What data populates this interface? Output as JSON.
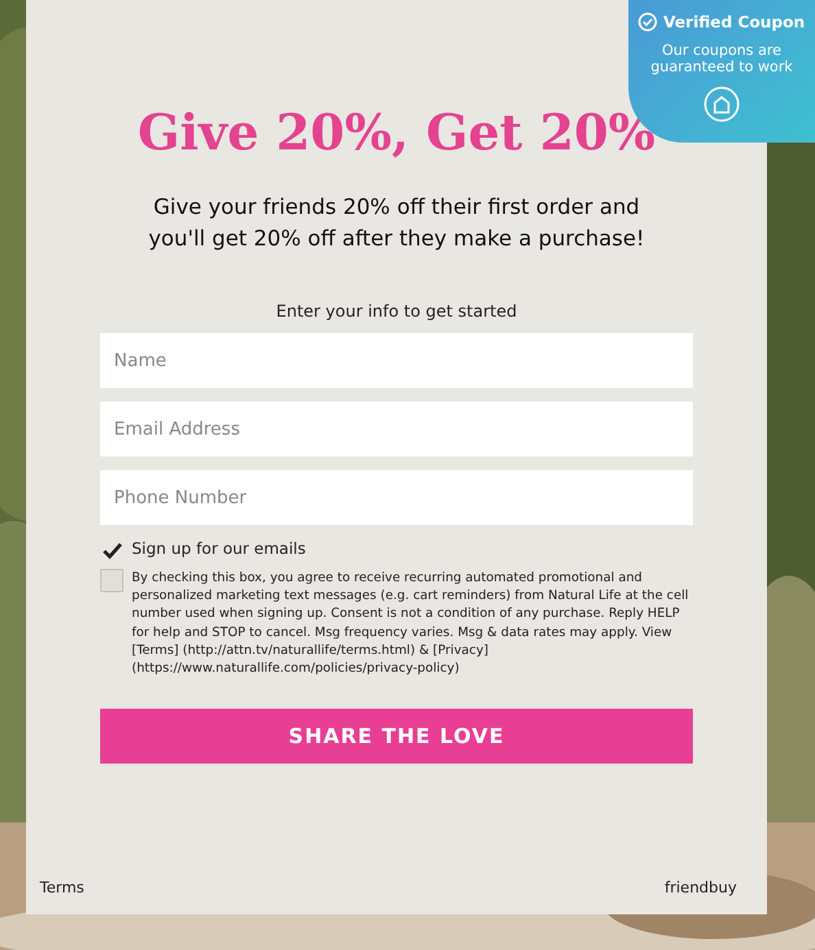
{
  "badge": {
    "title": "Verified Coupon",
    "text": "Our coupons are guaranteed to work"
  },
  "heading": "Give 20%, Get 20%",
  "subheading": "Give your friends 20% off their first order and you'll get 20% off after they make a purchase!",
  "form": {
    "intro": "Enter your info to get started",
    "fields": [
      {
        "placeholder": "Name"
      },
      {
        "placeholder": "Email Address"
      },
      {
        "placeholder": "Phone Number"
      }
    ],
    "checkboxes": [
      {
        "label": "Sign up for our emails",
        "checked": true
      },
      {
        "label": "By checking this box, you agree to receive recurring automated promotional and personalized marketing text messages (e.g. cart reminders) from Natural Life at the cell number used when signing up. Consent is not a condition of any purchase. Reply HELP for help and STOP to cancel. Msg frequency varies. Msg & data rates may apply. View [Terms] (http://attn.tv/naturallife/terms.html) & [Privacy] (https://www.naturallife.com/policies/privacy-policy)",
        "checked": false
      }
    ],
    "button": "SHARE THE LOVE"
  },
  "footer": {
    "left": "Terms",
    "right": "friendbuy"
  }
}
